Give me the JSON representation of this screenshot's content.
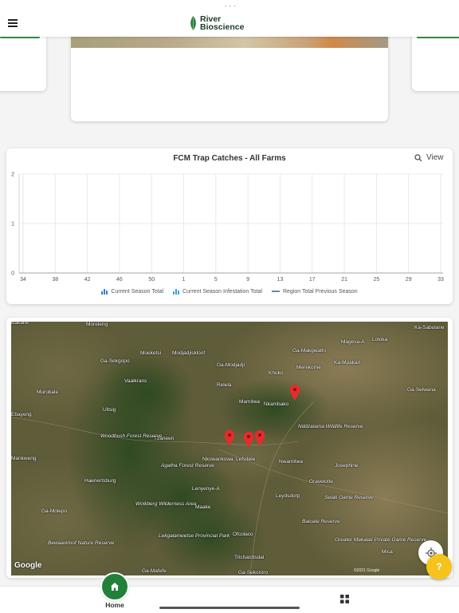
{
  "brand": {
    "line1": "River",
    "line2": "Bioscience",
    "accent": "#23803a"
  },
  "chart_section": {
    "title": "FCM Trap Catches - All Farms",
    "view_label": "View"
  },
  "chart_data": {
    "type": "bar",
    "categories": [
      "34",
      "38",
      "42",
      "46",
      "50",
      "1",
      "5",
      "9",
      "13",
      "17",
      "21",
      "25",
      "29",
      "33"
    ],
    "ylim": [
      0,
      2
    ],
    "yticks": [
      "0",
      "1",
      "2"
    ],
    "grid": true,
    "legend_position": "bottom",
    "series": [
      {
        "name": "Current Season Total",
        "values": [],
        "color": "#3a7bd5"
      },
      {
        "name": "Current Season Infestation Total",
        "values": [],
        "color": "#3aa0e0"
      },
      {
        "name": "Region Total Previous Season",
        "values": [],
        "color": "#3b5b8c"
      }
    ]
  },
  "map": {
    "places": [
      {
        "name": "Bakane"
      },
      {
        "name": "Moreleng"
      },
      {
        "name": "Moeketsi"
      },
      {
        "name": "Ga-Sekgopo"
      },
      {
        "name": "Vaalkrans"
      },
      {
        "name": "Modjadjiskloof"
      },
      {
        "name": "Ga-Modjadji"
      },
      {
        "name": "Ga-Makgwathi"
      },
      {
        "name": "Mageva-A"
      },
      {
        "name": "Loloka"
      },
      {
        "name": "Ka-Sabulane"
      },
      {
        "name": "Merekome"
      },
      {
        "name": "Ka-Mpakari"
      },
      {
        "name": "Khoko"
      },
      {
        "name": "Relela"
      },
      {
        "name": "Mamitwa"
      },
      {
        "name": "Nkambako"
      },
      {
        "name": "Ga-Selwana"
      },
      {
        "name": "Murobale"
      },
      {
        "name": "Uitsig"
      },
      {
        "name": "Ebayeng"
      },
      {
        "name": "Woodbush Forest Reserve"
      },
      {
        "name": "Tzaneen"
      },
      {
        "name": "Nkowankowa"
      },
      {
        "name": "Lefsitele"
      },
      {
        "name": "Nwamitwa"
      },
      {
        "name": "Nddzalama Wildlife Reserve"
      },
      {
        "name": "Mankweng"
      },
      {
        "name": "Agatha Forest Reserve"
      },
      {
        "name": "Josephine"
      },
      {
        "name": "Haenertsburg"
      },
      {
        "name": "Gravelotte"
      },
      {
        "name": "Lenyenye-A"
      },
      {
        "name": "Leydsdorp"
      },
      {
        "name": "Selati Game Reserve"
      },
      {
        "name": "Ga-Molepo"
      },
      {
        "name": "Wolkberg Wilderness Area"
      },
      {
        "name": "Maake"
      },
      {
        "name": "Baluale Reserve"
      },
      {
        "name": "Lekgalameetse Provincial Park"
      },
      {
        "name": "Ofcolaco"
      },
      {
        "name": "Greater Makalali Private Game Reserve"
      },
      {
        "name": "Bewaarkloof Nature Reserve"
      },
      {
        "name": "Trichardtsdal"
      },
      {
        "name": "Mica"
      },
      {
        "name": "Ga-Mafefe"
      },
      {
        "name": "Ga-Sekororo"
      }
    ],
    "google_label": "Google",
    "copyright": "©2021 Google",
    "marker_icon": "map-pin-icon"
  },
  "nav": {
    "home_label": "Home",
    "menu_icon": "grid-icon"
  },
  "help_label": "?"
}
